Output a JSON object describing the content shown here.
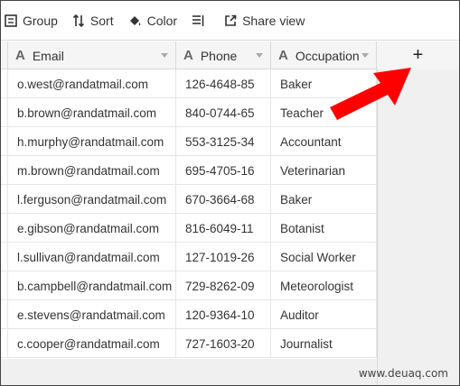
{
  "toolbar": {
    "group_label": "Group",
    "sort_label": "Sort",
    "color_label": "Color",
    "share_label": "Share view"
  },
  "columns": [
    {
      "name": "Email",
      "type_icon": "text-field-icon"
    },
    {
      "name": "Phone",
      "type_icon": "text-field-icon"
    },
    {
      "name": "Occupation",
      "type_icon": "text-field-icon"
    }
  ],
  "add_column_label": "+",
  "rows": [
    {
      "email": "o.west@randatmail.com",
      "phone": "126-4648-85",
      "occupation": "Baker"
    },
    {
      "email": "b.brown@randatmail.com",
      "phone": "840-0744-65",
      "occupation": "Teacher"
    },
    {
      "email": "h.murphy@randatmail.com",
      "phone": "553-3125-34",
      "occupation": "Accountant"
    },
    {
      "email": "m.brown@randatmail.com",
      "phone": "695-4705-16",
      "occupation": "Veterinarian"
    },
    {
      "email": "l.ferguson@randatmail.com",
      "phone": "670-3664-68",
      "occupation": "Baker"
    },
    {
      "email": "e.gibson@randatmail.com",
      "phone": "816-6049-11",
      "occupation": "Botanist"
    },
    {
      "email": "l.sullivan@randatmail.com",
      "phone": "127-1019-26",
      "occupation": "Social Worker"
    },
    {
      "email": "b.campbell@randatmail.com",
      "phone": "729-8262-09",
      "occupation": "Meteorologist"
    },
    {
      "email": "e.stevens@randatmail.com",
      "phone": "120-9364-10",
      "occupation": "Auditor"
    },
    {
      "email": "c.cooper@randatmail.com",
      "phone": "727-1603-20",
      "occupation": "Journalist"
    }
  ],
  "watermark": "www.deuaq.com",
  "colors": {
    "arrow": "#ff0000",
    "header_bg": "#f5f5f5",
    "side_bg": "#f0f0f0"
  }
}
